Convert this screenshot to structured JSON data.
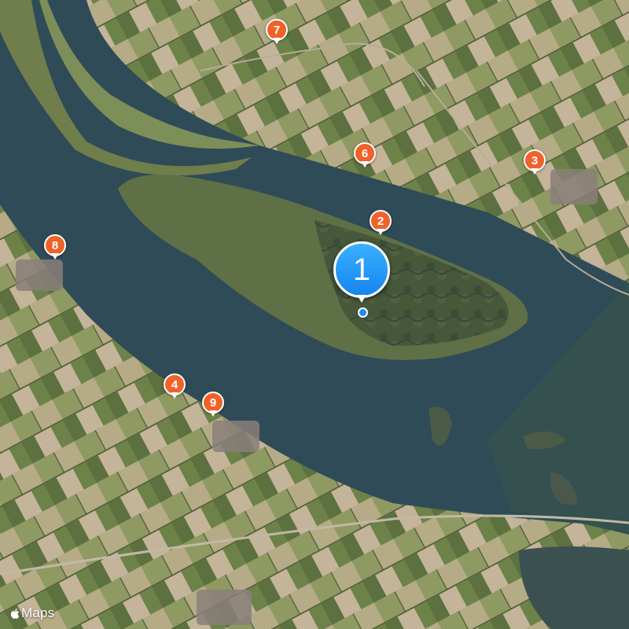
{
  "map": {
    "type": "satellite",
    "attribution_text": "Maps",
    "attribution_icon": "apple-logo-icon"
  },
  "markers": [
    {
      "label": "1",
      "kind": "primary",
      "color": "#1d8cf8"
    },
    {
      "label": "2",
      "kind": "secondary",
      "color": "#f0622a"
    },
    {
      "label": "3",
      "kind": "secondary",
      "color": "#f0622a"
    },
    {
      "label": "4",
      "kind": "secondary",
      "color": "#f0622a"
    },
    {
      "label": "6",
      "kind": "secondary",
      "color": "#f0622a"
    },
    {
      "label": "7",
      "kind": "secondary",
      "color": "#f0622a"
    },
    {
      "label": "8",
      "kind": "secondary",
      "color": "#f0622a"
    },
    {
      "label": "9",
      "kind": "secondary",
      "color": "#f0622a"
    }
  ],
  "colors": {
    "water": "#2f4b58",
    "farmland": "#6e7a4c",
    "marker_orange": "#f0622a",
    "marker_blue": "#1d8cf8"
  }
}
